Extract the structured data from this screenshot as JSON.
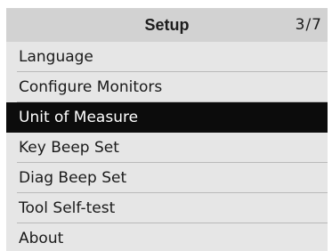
{
  "header": {
    "title": "Setup",
    "page_indicator": "3/7"
  },
  "menu": {
    "selected_index": 2,
    "items": [
      {
        "label": "Language"
      },
      {
        "label": "Configure Monitors"
      },
      {
        "label": "Unit of Measure"
      },
      {
        "label": "Key Beep Set"
      },
      {
        "label": "Diag Beep Set"
      },
      {
        "label": "Tool Self-test"
      },
      {
        "label": "About"
      }
    ]
  },
  "colors": {
    "header_bg": "#d2d2d2",
    "list_bg": "#e6e6e6",
    "selected_bg": "#0c0c0c",
    "selected_text": "#ffffff",
    "text": "#1a1a1a"
  }
}
